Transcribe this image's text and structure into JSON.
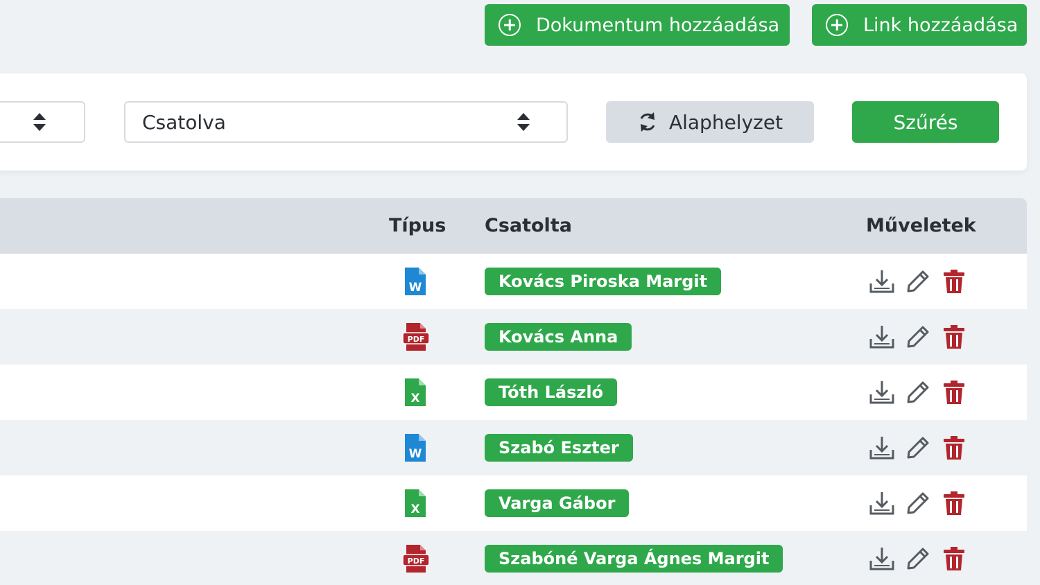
{
  "header": {
    "add_document_label": "Dokumentum hozzáadása",
    "add_link_label": "Link hozzáadása"
  },
  "filters": {
    "first_select_value": "",
    "status_select_value": "Csatolva",
    "reset_label": "Alaphelyzet",
    "filter_label": "Szűrés"
  },
  "table": {
    "columns": {
      "type": "Típus",
      "attached_by": "Csatolta",
      "actions": "Műveletek"
    },
    "rows": [
      {
        "file_type": "word",
        "attached_by": "Kovács Piroska Margit"
      },
      {
        "file_type": "pdf",
        "attached_by": "Kovács Anna"
      },
      {
        "file_type": "excel",
        "attached_by": "Tóth László"
      },
      {
        "file_type": "word",
        "attached_by": "Szabó Eszter"
      },
      {
        "file_type": "excel",
        "attached_by": "Varga Gábor"
      },
      {
        "file_type": "pdf",
        "attached_by": "Szabóné Varga Ágnes Margit"
      }
    ]
  },
  "icons": {
    "add": "plus-circle-icon",
    "reset": "refresh-icon",
    "sort": "sort-icon",
    "download": "download-icon",
    "edit": "pencil-icon",
    "delete": "trash-icon",
    "word": "word-file-icon",
    "excel": "excel-file-icon",
    "pdf": "pdf-file-icon"
  },
  "colors": {
    "primary_green": "#2ea84a",
    "word_blue": "#1e88d4",
    "pdf_red": "#b3252d",
    "excel_green": "#2ea84a",
    "delete_red": "#b3252d",
    "icon_gray": "#555b61"
  }
}
